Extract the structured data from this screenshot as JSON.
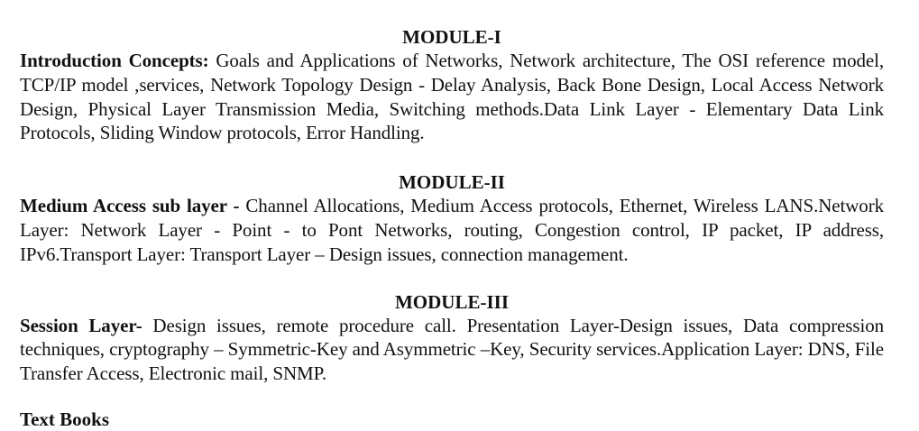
{
  "modules": [
    {
      "title": "MODULE-I",
      "heading": "Introduction Concepts:",
      "body": " Goals and Applications of Networks, Network architecture, The OSI reference model, TCP/IP model ,services, Network Topology Design - Delay Analysis, Back Bone Design, Local Access Network Design, Physical Layer Transmission Media, Switching methods.Data Link Layer - Elementary Data Link Protocols, Sliding Window protocols, Error Handling."
    },
    {
      "title": "MODULE-II",
      "heading": "Medium Access sub layer -",
      "body": " Channel Allocations, Medium Access protocols, Ethernet, Wireless LANS.Network Layer: Network Layer - Point - to Pont Networks, routing, Congestion control, IP packet, IP address, IPv6.Transport Layer: Transport Layer – Design issues, connection management."
    },
    {
      "title": "MODULE-III",
      "heading": "Session Layer-",
      "body": " Design issues, remote procedure call. Presentation Layer-Design issues, Data compression techniques, cryptography – Symmetric-Key and Asymmetric –Key, Security services.Application Layer: DNS, File Transfer Access, Electronic mail, SNMP."
    },
    {
      "next_heading": "Text Books"
    }
  ]
}
